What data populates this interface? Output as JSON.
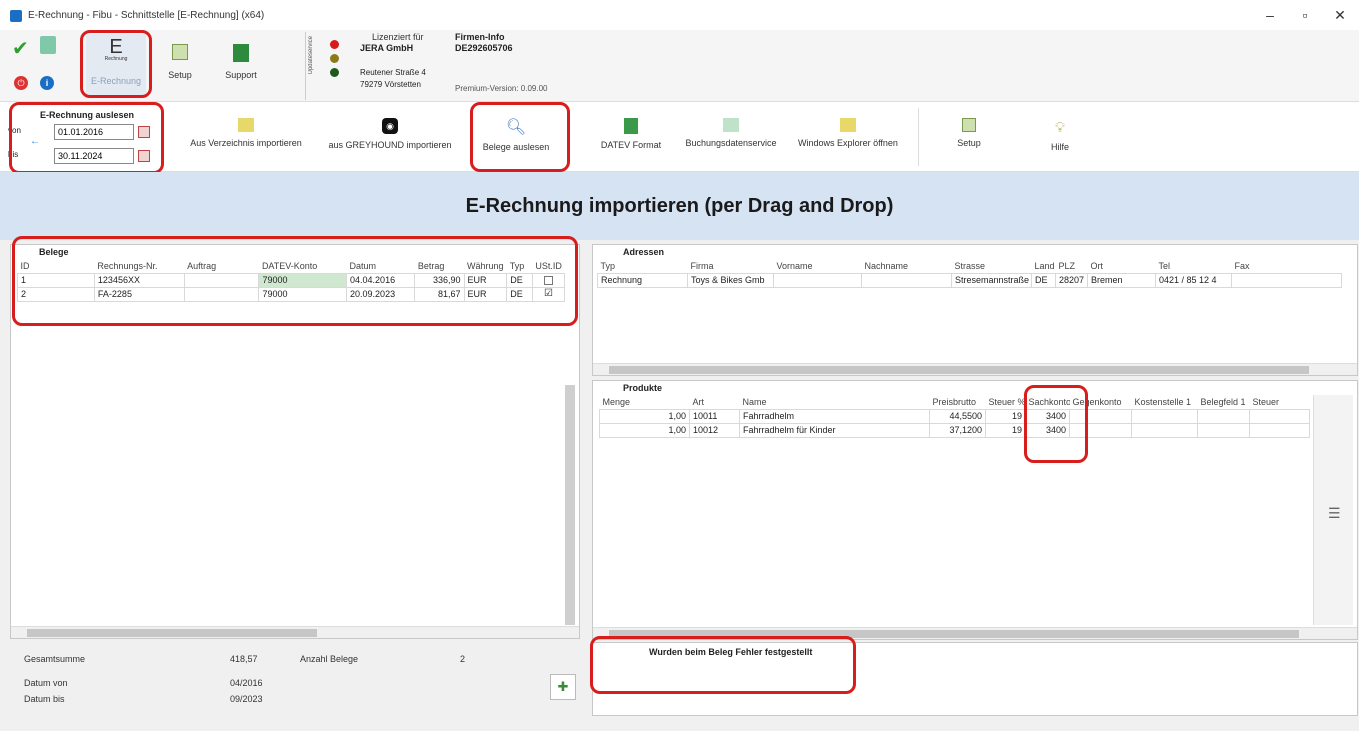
{
  "window": {
    "title": "E-Rechnung - Fibu - Schnittstelle [E-Rechnung] (x64)",
    "min": "–",
    "max": "▫",
    "close": "✕"
  },
  "ribbon": {
    "erechnung_label": "E-Rechnung",
    "erechnung_icon_text": "E",
    "erechnung_icon_sub": "Rechnung",
    "setup_label": "Setup",
    "support_label": "Support",
    "updateservice_label": "Updateservice",
    "lizenziert_label": "Lizenziert für",
    "company": "JERA GmbH",
    "street": "Reutener Straße 4",
    "city": "79279 Vörstetten",
    "firmen_info_label": "Firmen-Info",
    "vat_id": "DE292605706",
    "version": "Premium-Version: 0.09.00"
  },
  "auslesen": {
    "title": "E-Rechnung auslesen",
    "von_label": "von",
    "bis_label": "bis",
    "von_value": "01.01.2016",
    "bis_value": "30.11.2024"
  },
  "toolbar": {
    "aus_verzeichnis": "Aus Verzeichnis importieren",
    "aus_greyhound": "aus GREYHOUND importieren",
    "belege_auslesen": "Belege auslesen",
    "datev_format": "DATEV Format",
    "buchungsdatenservice": "Buchungsdatenservice",
    "windows_explorer": "Windows Explorer öffnen",
    "setup": "Setup",
    "hilfe": "Hilfe"
  },
  "banner": {
    "title": "E-Rechnung importieren (per Drag and Drop)"
  },
  "belege": {
    "title": "Belege",
    "columns": [
      "ID",
      "Rechnungs-Nr.",
      "Auftrag",
      "DATEV-Konto",
      "Datum",
      "Betrag",
      "Währung",
      "Typ",
      "USt.ID"
    ],
    "rows": [
      {
        "id": "1",
        "rechnung": "123456XX",
        "auftrag": "",
        "konto": "79000",
        "datum": "04.04.2016",
        "betrag": "336,90",
        "waehrung": "EUR",
        "typ": "DE",
        "ustid": ""
      },
      {
        "id": "2",
        "rechnung": "FA-2285",
        "auftrag": "",
        "konto": "79000",
        "datum": "20.09.2023",
        "betrag": "81,67",
        "waehrung": "EUR",
        "typ": "DE",
        "ustid": "☑"
      }
    ]
  },
  "summary": {
    "gesamtsumme_label": "Gesamtsumme",
    "gesamtsumme": "418,57",
    "anzahl_label": "Anzahl Belege",
    "anzahl": "2",
    "datum_von_label": "Datum von",
    "datum_von": "04/2016",
    "datum_bis_label": "Datum bis",
    "datum_bis": "09/2023"
  },
  "adressen": {
    "title": "Adressen",
    "columns": [
      "Typ",
      "Firma",
      "Vorname",
      "Nachname",
      "Strasse",
      "Land",
      "PLZ",
      "Ort",
      "Tel",
      "Fax"
    ],
    "rows": [
      {
        "typ": "Rechnung",
        "firma": "Toys & Bikes Gmb",
        "vorname": "",
        "nachname": "",
        "strasse": "Stresemannstraße",
        "land": "DE",
        "plz": "28207",
        "ort": "Bremen",
        "tel": "0421 / 85 12 4",
        "fax": ""
      }
    ]
  },
  "produkte": {
    "title": "Produkte",
    "columns": [
      "Menge",
      "Art",
      "Name",
      "Preisbrutto",
      "Steuer %",
      "Sachkonto",
      "Gegenkonto",
      "Kostenstelle 1",
      "Belegfeld 1",
      "Steuer"
    ],
    "rows": [
      {
        "menge": "1,00",
        "art": "10011",
        "name": "Fahrradhelm",
        "preis": "44,5500",
        "steuer": "19",
        "sachkonto": "3400"
      },
      {
        "menge": "1,00",
        "art": "10012",
        "name": "Fahrradhelm für Kinder",
        "preis": "37,1200",
        "steuer": "19",
        "sachkonto": "3400"
      }
    ]
  },
  "fehler": {
    "title": "Wurden beim Beleg Fehler festgestellt"
  },
  "colors": {
    "banner": "#d5e3f3",
    "highlight": "#d81d1d",
    "konto_cell": "#cfe8cf"
  }
}
